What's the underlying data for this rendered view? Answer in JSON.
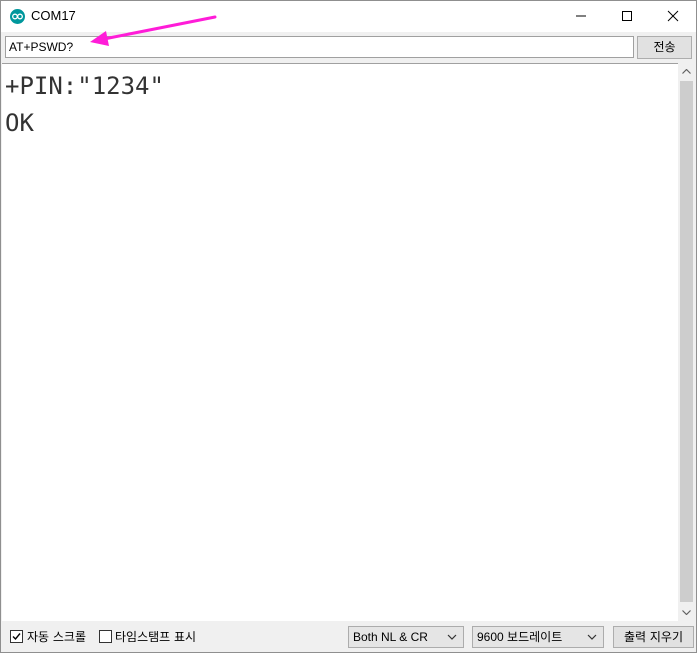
{
  "window": {
    "title": "COM17",
    "app_icon": "arduino-icon"
  },
  "controls": {
    "minimize_icon": "minimize-icon",
    "maximize_icon": "maximize-icon",
    "close_icon": "close-icon"
  },
  "input": {
    "value": "AT+PSWD?",
    "send_label": "전송"
  },
  "annotation": {
    "arrow_color": "#ff1cd8",
    "icon": "arrow-annotation-icon"
  },
  "output": {
    "lines": [
      "+PIN:\"1234\"",
      "OK"
    ]
  },
  "footer": {
    "autoscroll": {
      "label": "자동 스크롤",
      "checked": true
    },
    "timestamp": {
      "label": "타임스탬프 표시",
      "checked": false
    },
    "line_ending": "Both NL & CR",
    "baud_rate": "9600 보드레이트",
    "clear_label": "출력 지우기"
  },
  "colors": {
    "accent": "#00979c",
    "output_text": "#333333"
  }
}
